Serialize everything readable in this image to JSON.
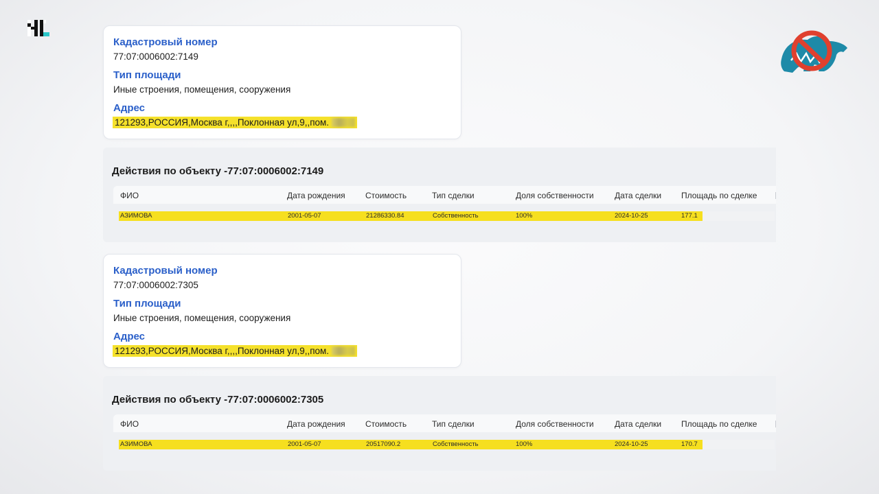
{
  "objects": [
    {
      "card": {
        "cadastral_label": "Кадастровый номер",
        "cadastral_value": "77:07:0006002:7149",
        "area_type_label": "Тип площади",
        "area_type_value": "Иные строения, помещения, сооружения",
        "address_label": "Адрес",
        "address_value": "121293,РОССИЯ,Москва г,,,,Поклонная ул,9,,пом."
      },
      "actions": {
        "title": "Действия по объекту -77:07:0006002:7149",
        "row": {
          "fio": "АЗИМОВА",
          "birth": "2001-05-07",
          "cost": "21286330.84",
          "deal_type": "Собственность",
          "share": "100%",
          "deal_date": "2024-10-25",
          "area": "177.1"
        }
      }
    },
    {
      "card": {
        "cadastral_label": "Кадастровый номер",
        "cadastral_value": "77:07:0006002:7305",
        "area_type_label": "Тип площади",
        "area_type_value": "Иные строения, помещения, сооружения",
        "address_label": "Адрес",
        "address_value": "121293,РОССИЯ,Москва г,,,,Поклонная ул,9,,пом."
      },
      "actions": {
        "title": "Действия по объекту -77:07:0006002:7305",
        "row": {
          "fio": "АЗИМОВА",
          "birth": "2001-05-07",
          "cost": "20517090.2",
          "deal_type": "Собственность",
          "share": "100%",
          "deal_date": "2024-10-25",
          "area": "170.7"
        }
      }
    }
  ],
  "table_columns": {
    "fio": "ФИО",
    "birth": "Дата рождения",
    "cost": "Стоимость",
    "deal_type": "Тип сделки",
    "share": "Доля собственности",
    "deal_date": "Дата сделки",
    "area": "Площадь по сделке"
  },
  "colors": {
    "label_blue": "#2a5fc9",
    "highlight_yellow": "#f6df1f",
    "logo_red": "#e0402e",
    "logo_teal": "#1e8aa8"
  },
  "icons": {
    "top_left": "channel-logo-icon",
    "top_right": "crossed-out-bear-logo-icon"
  }
}
